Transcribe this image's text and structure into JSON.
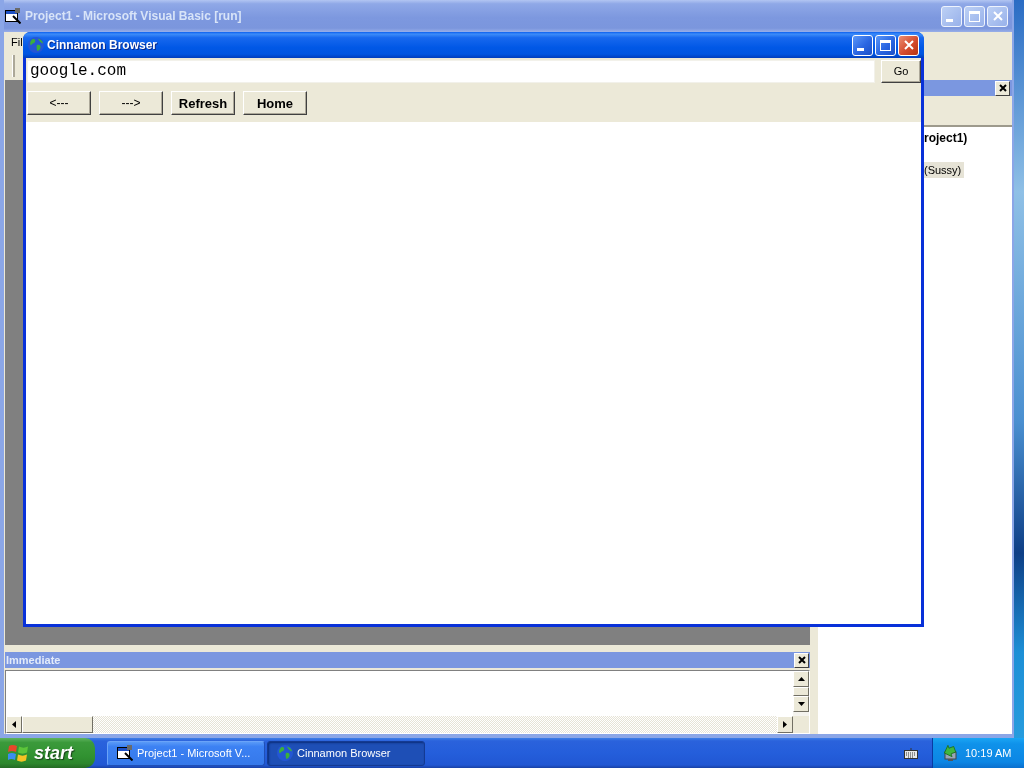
{
  "ide_window": {
    "title": "Project1 - Microsoft Visual Basic [run]",
    "active": false,
    "menu": [
      "Fil"
    ],
    "project_panel": {
      "items": [
        {
          "label": "roject1)",
          "bold": true,
          "selected": false
        },
        {
          "label": "(Sussy)",
          "bold": false,
          "selected": true
        }
      ]
    },
    "immediate": {
      "title": "Immediate"
    }
  },
  "browser_window": {
    "title": "Cinnamon Browser",
    "active": true,
    "address": {
      "value": "google.com"
    },
    "go_button": "Go",
    "nav_buttons": [
      {
        "label": "<---",
        "bold": false
      },
      {
        "label": "--->",
        "bold": false
      },
      {
        "label": "Refresh",
        "bold": true
      },
      {
        "label": "Home",
        "bold": true
      }
    ]
  },
  "taskbar": {
    "start": "start",
    "tasks": [
      {
        "label": "Project1 - Microsoft V...",
        "kind": "vb",
        "selected": false
      },
      {
        "label": "Cinnamon Browser",
        "kind": "globe",
        "selected": true
      }
    ],
    "clock": "10:19 AM"
  }
}
